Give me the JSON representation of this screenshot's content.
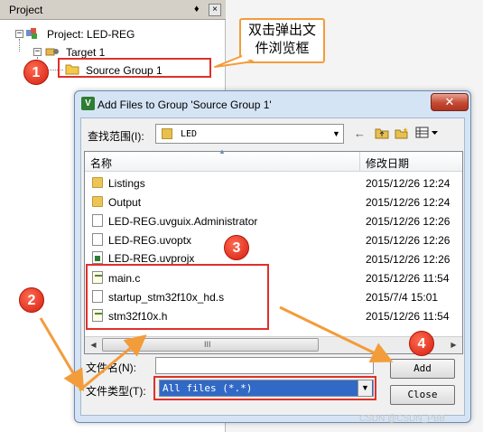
{
  "project_panel": {
    "title": "Project",
    "pin": "♦",
    "close": "×",
    "project_label": "Project: LED-REG",
    "target_label": "Target 1",
    "group_label": "Source Group 1",
    "expander_minus": "−"
  },
  "callout": {
    "text": "双击弹出文件浏览框"
  },
  "badges": {
    "b1": "1",
    "b2": "2",
    "b3": "3",
    "b4": "4"
  },
  "dialog": {
    "title": "Add Files to Group 'Source Group 1'",
    "app_icon": "V",
    "close": "✕",
    "look_in_label": "查找范围(I):",
    "look_in_value": "LED",
    "dropdown_arrow": "▼",
    "toolbar": {
      "back": "←",
      "up": "📁",
      "new": "✱",
      "view": "▦▾"
    },
    "columns": {
      "name": "名称",
      "date": "修改日期"
    },
    "sort_arrow": "▲",
    "files": [
      {
        "name": "Listings",
        "date": "2015/12/26 12:24",
        "icon": "folder"
      },
      {
        "name": "Output",
        "date": "2015/12/26 12:24",
        "icon": "folder"
      },
      {
        "name": "LED-REG.uvguix.Administrator",
        "date": "2015/12/26 12:26",
        "icon": "file"
      },
      {
        "name": "LED-REG.uvoptx",
        "date": "2015/12/26 12:26",
        "icon": "file"
      },
      {
        "name": "LED-REG.uvprojx",
        "date": "2015/12/26 12:26",
        "icon": "project"
      },
      {
        "name": "main.c",
        "date": "2015/12/26 11:54",
        "icon": "c-file"
      },
      {
        "name": "startup_stm32f10x_hd.s",
        "date": "2015/7/4 15:01",
        "icon": "file"
      },
      {
        "name": "stm32f10x.h",
        "date": "2015/12/26 11:54",
        "icon": "c-file"
      }
    ],
    "scroll": {
      "left": "◀",
      "grip": "III",
      "right": "▶"
    },
    "file_name_label": "文件名(N):",
    "file_name_value": "",
    "file_type_label": "文件类型(T):",
    "file_type_value": "All files (*.*)",
    "add_button": "Add",
    "close_button": "Close"
  },
  "watermark": "CSDN @CSDN_PBB",
  "colors": {
    "annotation": "#e0302a",
    "callout_border": "#f39c3a",
    "selection": "#3169c6"
  }
}
